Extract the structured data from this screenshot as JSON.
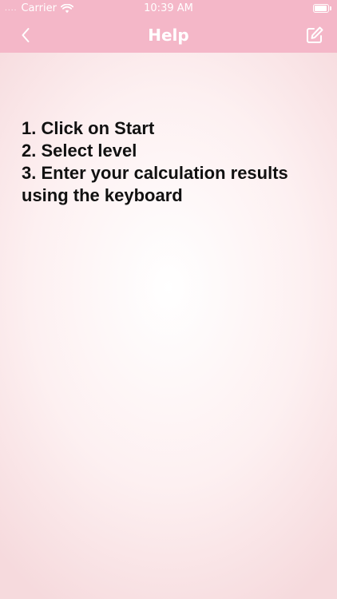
{
  "status_bar": {
    "signal_dots": "....",
    "carrier": "Carrier",
    "time": "10:39 AM"
  },
  "navbar": {
    "title": "Help"
  },
  "help": {
    "steps": [
      "1. Click on Start",
      "2. Select level",
      "3. Enter your calculation results using the keyboard"
    ]
  },
  "colors": {
    "header": "#f4b7c8",
    "header_text": "#ffffff",
    "body_text": "#111111",
    "background_center": "#ffffff",
    "background_edge": "#f6dadd"
  },
  "icons": {
    "back": "chevron-left-icon",
    "edit": "compose-icon",
    "wifi": "wifi-icon",
    "battery": "battery-icon"
  }
}
